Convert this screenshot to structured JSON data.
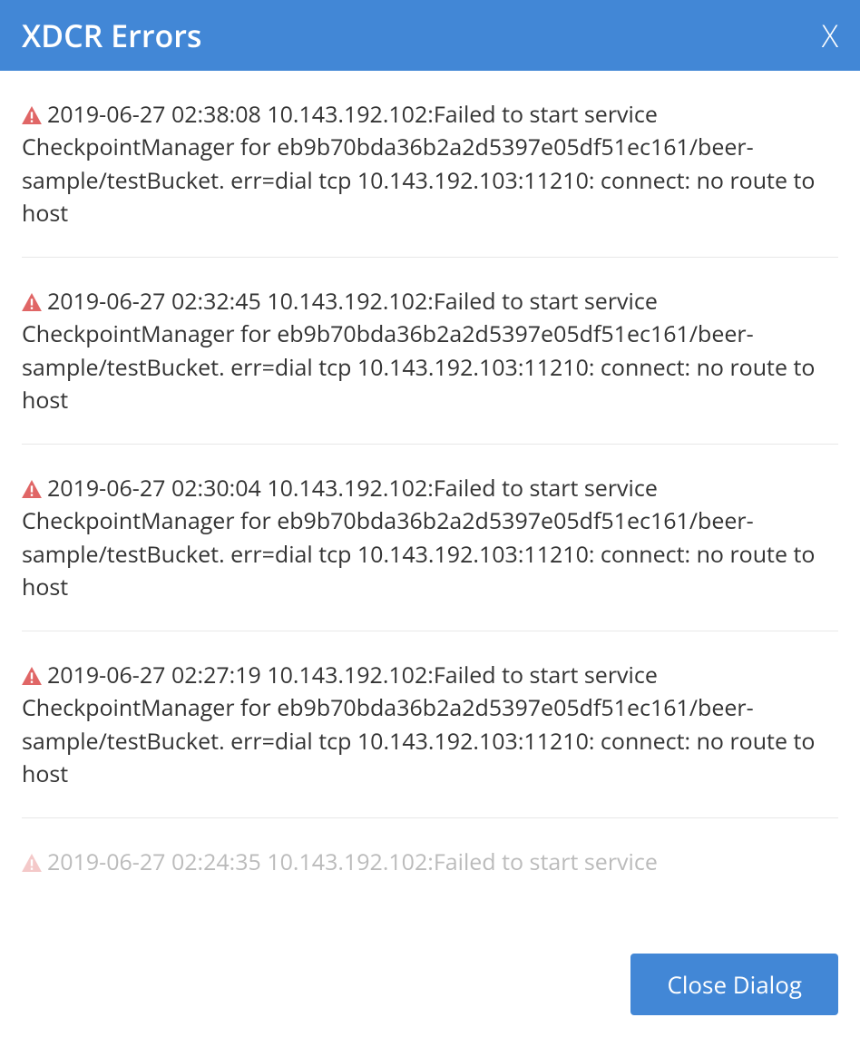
{
  "dialog": {
    "title": "XDCR Errors",
    "close_x": "X",
    "close_button": "Close Dialog"
  },
  "errors": [
    {
      "message": "2019-06-27 02:38:08 10.143.192.102:Failed to start service CheckpointManager for eb9b70bda36b2a2d5397e05df51ec161/beer-sample/testBucket. err=dial tcp 10.143.192.103:11210: connect: no route to host"
    },
    {
      "message": "2019-06-27 02:32:45 10.143.192.102:Failed to start service CheckpointManager for eb9b70bda36b2a2d5397e05df51ec161/beer-sample/testBucket. err=dial tcp 10.143.192.103:11210: connect: no route to host"
    },
    {
      "message": "2019-06-27 02:30:04 10.143.192.102:Failed to start service CheckpointManager for eb9b70bda36b2a2d5397e05df51ec161/beer-sample/testBucket. err=dial tcp 10.143.192.103:11210: connect: no route to host"
    },
    {
      "message": "2019-06-27 02:27:19 10.143.192.102:Failed to start service CheckpointManager for eb9b70bda36b2a2d5397e05df51ec161/beer-sample/testBucket. err=dial tcp 10.143.192.103:11210: connect: no route to host"
    },
    {
      "message": "2019-06-27 02:24:35 10.143.192.102:Failed to start service"
    }
  ],
  "icons": {
    "warning": "warning-icon"
  },
  "colors": {
    "header_bg": "#4287d6",
    "warning": "#e06666",
    "text": "#333333"
  }
}
